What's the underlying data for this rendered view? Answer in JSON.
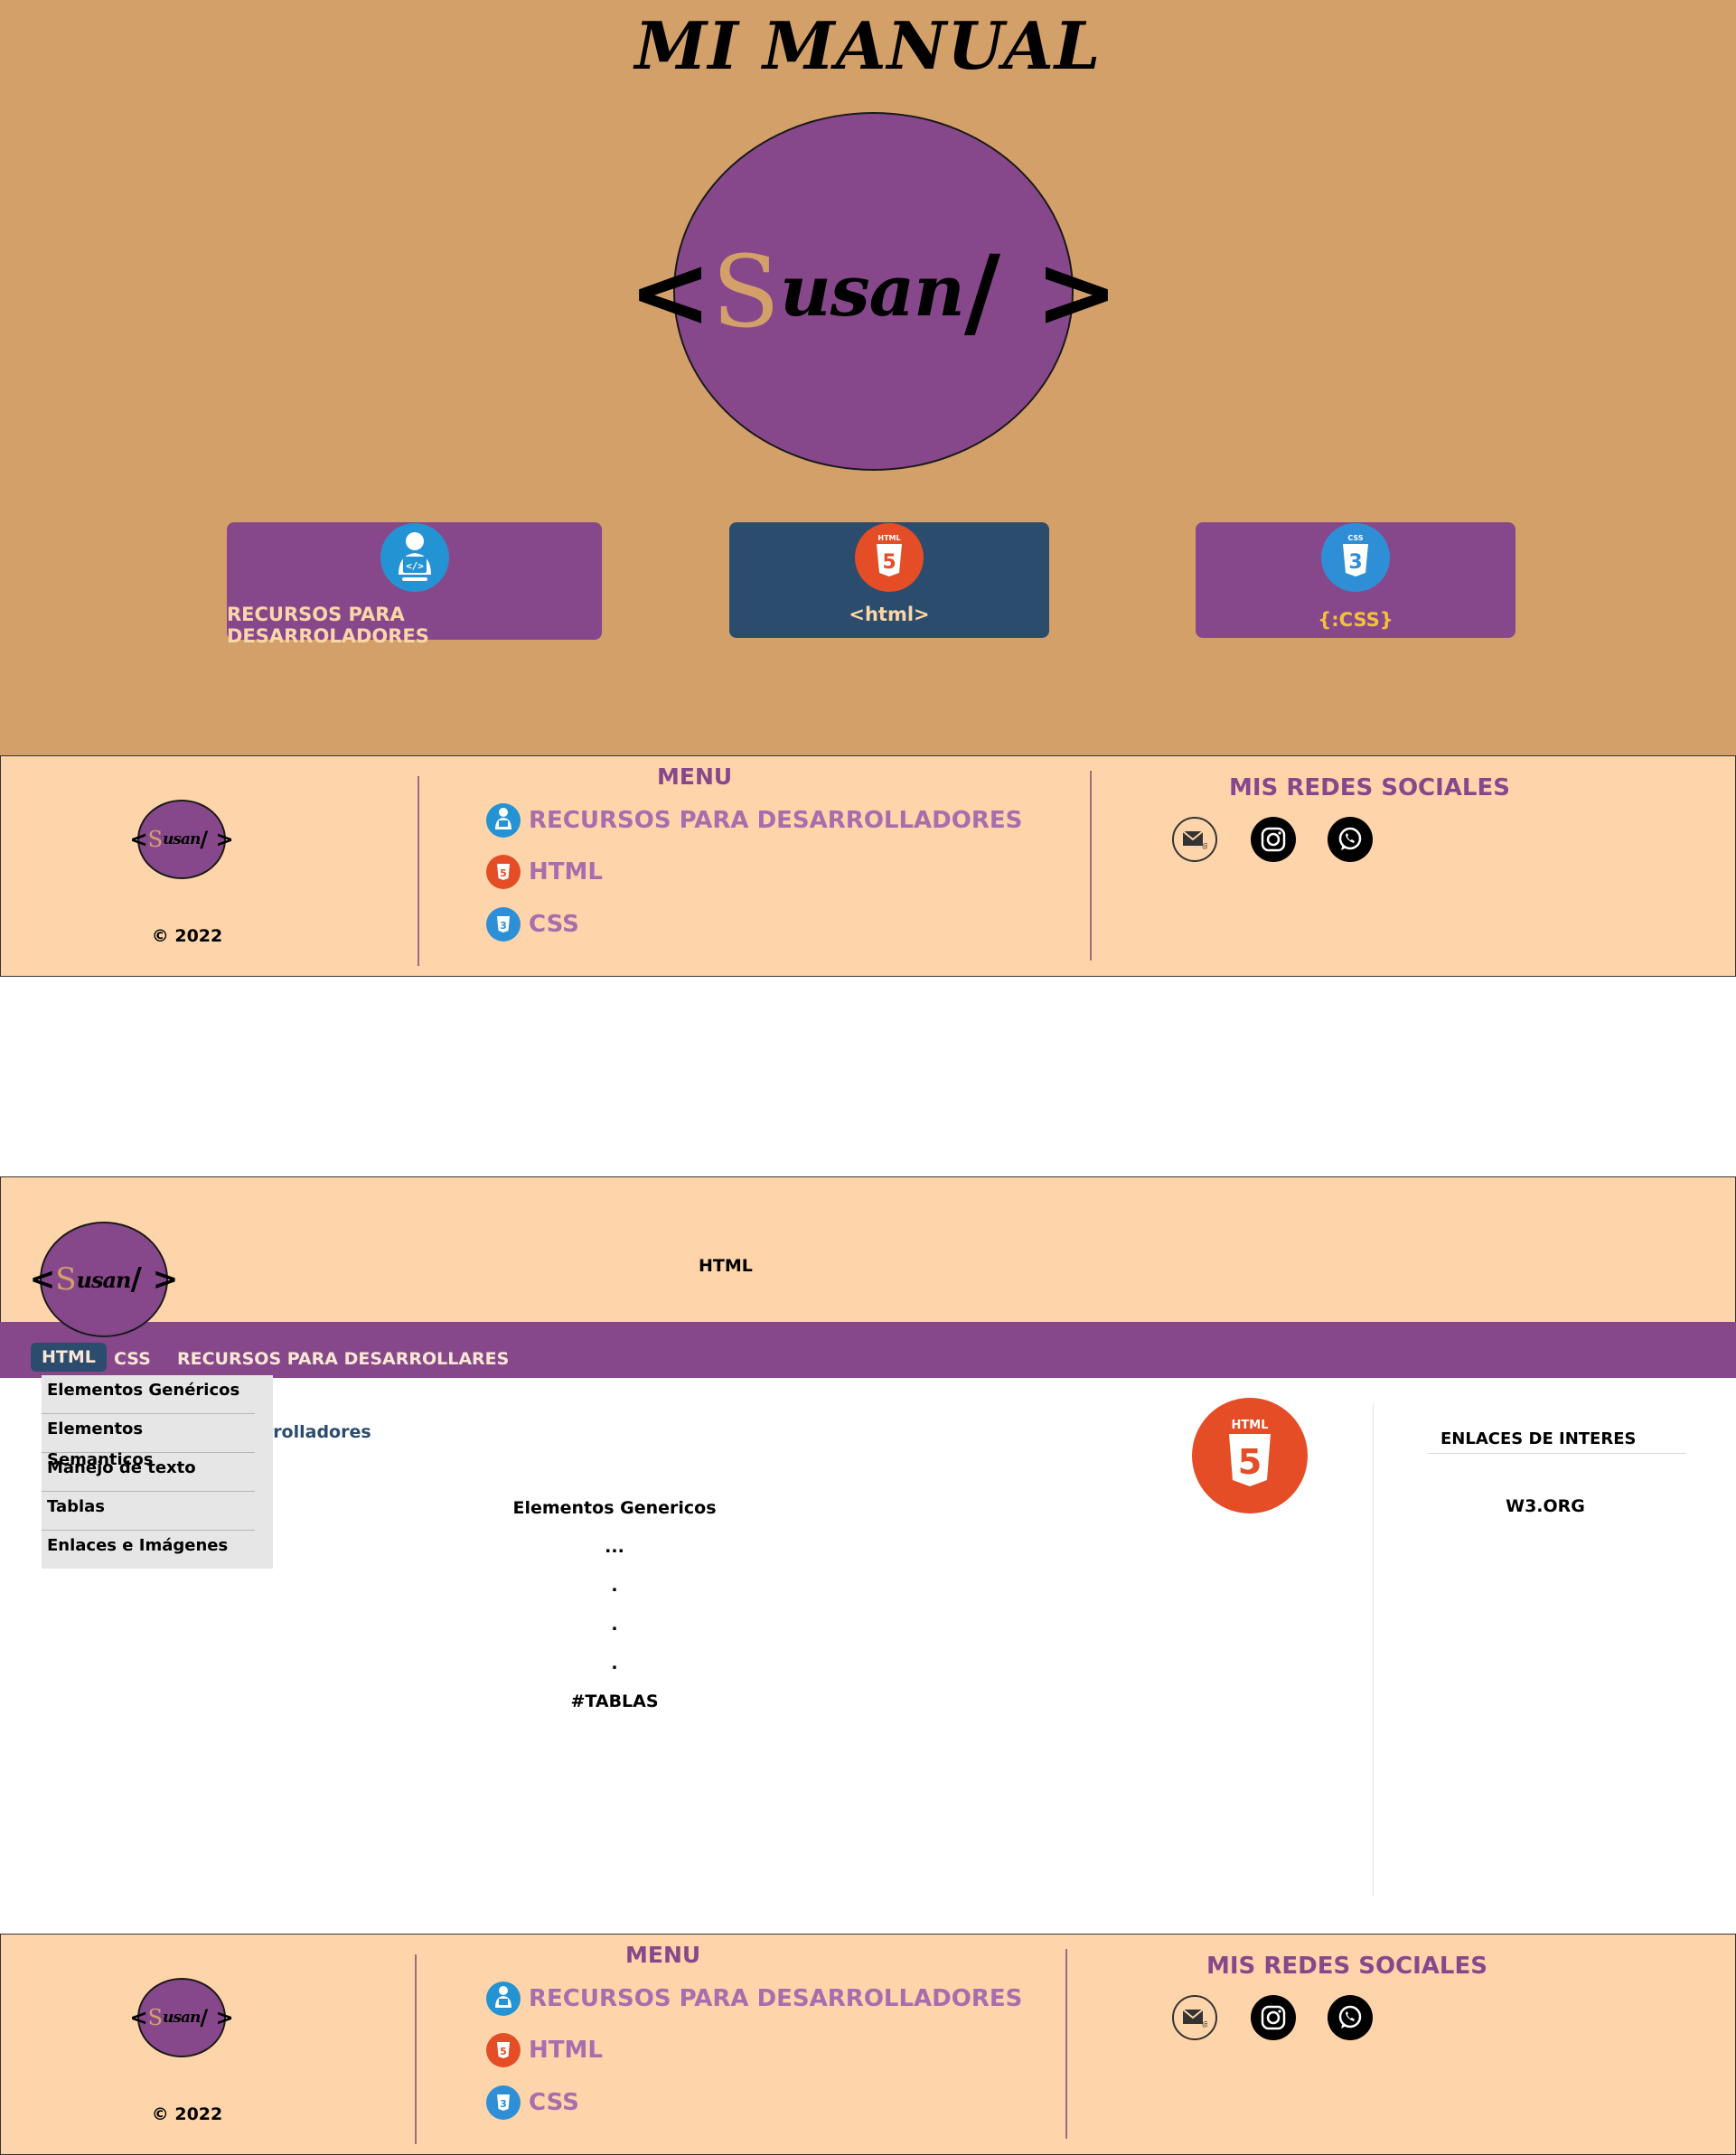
{
  "hero": {
    "title": "MI MANUAL",
    "logo": {
      "open": "<",
      "s": "S",
      "rest": "usan",
      "close": "/ >"
    },
    "cards": [
      {
        "label": "RECURSOS PARA DESARROLADORES",
        "icon": "developer-icon"
      },
      {
        "label": "<html>",
        "icon": "html5-icon"
      },
      {
        "label": "{:CSS}",
        "icon": "css3-icon"
      }
    ]
  },
  "footer": {
    "logo": {
      "open": "<",
      "s": "S",
      "rest": "usan",
      "close": "/ >"
    },
    "copyright": "© 2022",
    "menu_title": "MENU",
    "links": [
      {
        "label": "RECURSOS PARA DESARROLLADORES",
        "icon": "developer-icon"
      },
      {
        "label": "HTML",
        "icon": "html5-icon"
      },
      {
        "label": "CSS",
        "icon": "css3-icon"
      }
    ],
    "social_title": "MIS REDES SOCIALES",
    "social_icons": [
      "email-icon",
      "instagram-icon",
      "whatsapp-icon"
    ]
  },
  "html_page": {
    "header_title": "HTML",
    "logo": {
      "open": "<",
      "s": "S",
      "rest": "usan",
      "close": "/ >"
    },
    "nav": {
      "html": "HTML",
      "css": "CSS",
      "recursos": "RECURSOS PARA DESARROLLARES"
    },
    "dropdown": [
      "Elementos Genéricos",
      "Elementos Semanticos",
      "Manejo de texto",
      "Tablas",
      "Enlaces e Imágenes"
    ],
    "breadcrumb_partial": "arrolladores",
    "content": [
      "Elementos Genericos",
      "...",
      ".",
      ".",
      ".",
      "#TABLAS"
    ],
    "sidebar": {
      "title": "ENLACES DE INTERES",
      "link": "W3.ORG"
    }
  },
  "colors": {
    "purple": "#87488b",
    "tan": "#d4a06a",
    "peach": "#fed5aa",
    "navy": "#2b4c6d",
    "html_orange": "#e44d26",
    "css_blue": "#2f8fd6"
  }
}
